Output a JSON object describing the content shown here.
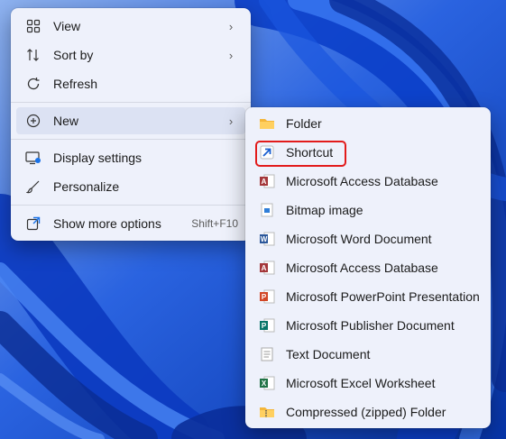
{
  "context_menu": {
    "items": [
      {
        "label": "View",
        "icon": "view-grid-icon",
        "has_submenu": true
      },
      {
        "label": "Sort by",
        "icon": "sort-icon",
        "has_submenu": true
      },
      {
        "label": "Refresh",
        "icon": "refresh-icon"
      },
      {
        "label": "New",
        "icon": "new-plus-icon",
        "has_submenu": true,
        "highlighted": true
      },
      {
        "label": "Display settings",
        "icon": "display-settings-icon"
      },
      {
        "label": "Personalize",
        "icon": "personalize-brush-icon"
      },
      {
        "label": "Show more options",
        "icon": "show-more-options-icon",
        "shortcut": "Shift+F10"
      }
    ]
  },
  "new_submenu": {
    "items": [
      {
        "label": "Folder",
        "icon": "folder-icon"
      },
      {
        "label": "Shortcut",
        "icon": "shortcut-icon",
        "outlined": true
      },
      {
        "label": "Microsoft Access Database",
        "icon": "access-icon"
      },
      {
        "label": "Bitmap image",
        "icon": "bitmap-icon"
      },
      {
        "label": "Microsoft Word Document",
        "icon": "word-icon"
      },
      {
        "label": "Microsoft Access Database",
        "icon": "access-icon"
      },
      {
        "label": "Microsoft PowerPoint Presentation",
        "icon": "powerpoint-icon"
      },
      {
        "label": "Microsoft Publisher Document",
        "icon": "publisher-icon"
      },
      {
        "label": "Text Document",
        "icon": "text-document-icon"
      },
      {
        "label": "Microsoft Excel Worksheet",
        "icon": "excel-icon"
      },
      {
        "label": "Compressed (zipped) Folder",
        "icon": "zip-folder-icon"
      }
    ]
  },
  "colors": {
    "menu_bg": "#eef1fb",
    "highlight": "#dce2f3",
    "outline_red": "#e21b1b",
    "wallpaper_blue": "#0a3fc4"
  }
}
